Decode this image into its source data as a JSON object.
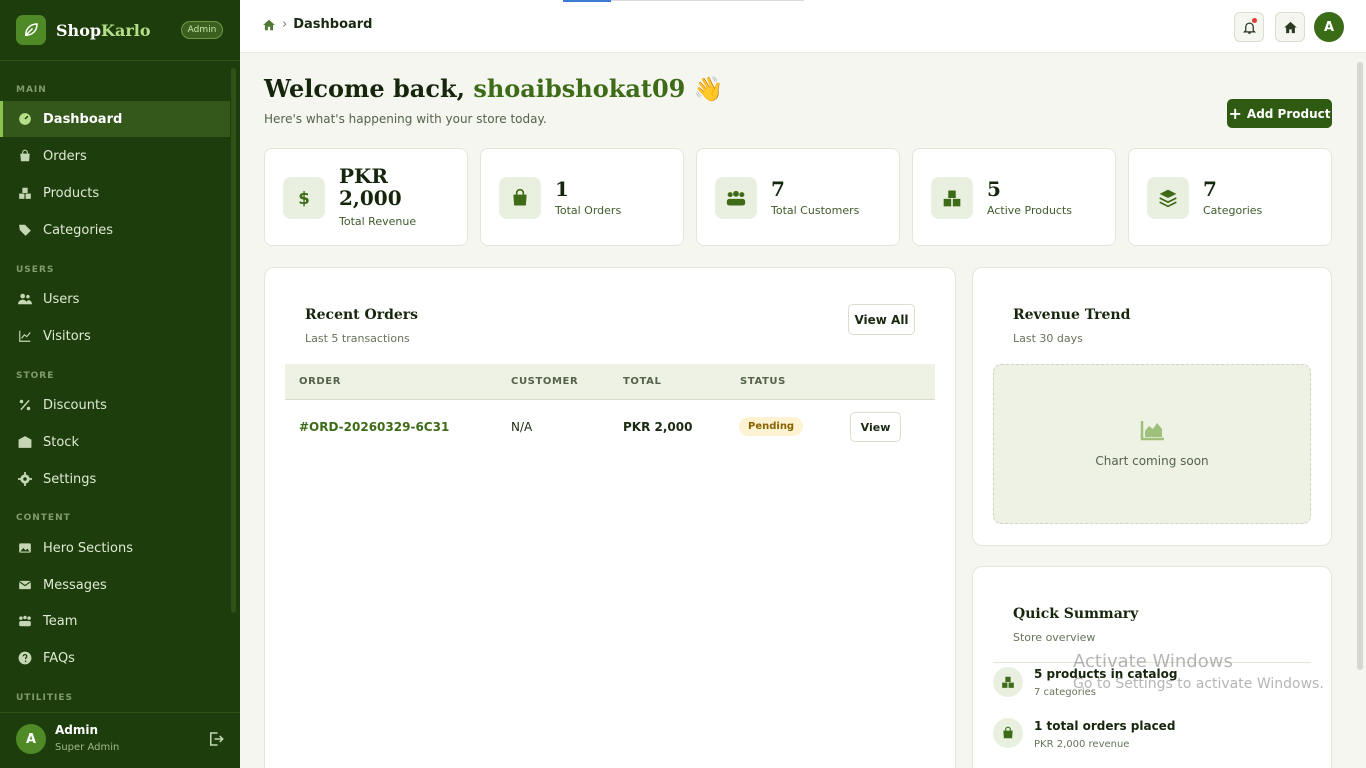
{
  "brand": {
    "name_part1": "Shop",
    "name_part2": "Karlo",
    "badge": "Admin"
  },
  "sidebar": {
    "sections": [
      "MAIN",
      "USERS",
      "STORE",
      "CONTENT",
      "UTILITIES"
    ],
    "items": [
      {
        "label": "Dashboard",
        "icon": "dashboard-icon",
        "active": true
      },
      {
        "label": "Orders",
        "icon": "bag-icon"
      },
      {
        "label": "Products",
        "icon": "boxes-icon"
      },
      {
        "label": "Categories",
        "icon": "tag-icon"
      },
      {
        "label": "Users",
        "icon": "users-icon"
      },
      {
        "label": "Visitors",
        "icon": "chart-line-icon"
      },
      {
        "label": "Discounts",
        "icon": "percent-icon"
      },
      {
        "label": "Stock",
        "icon": "warehouse-icon"
      },
      {
        "label": "Settings",
        "icon": "gear-icon"
      },
      {
        "label": "Hero Sections",
        "icon": "image-icon"
      },
      {
        "label": "Messages",
        "icon": "envelope-icon"
      },
      {
        "label": "Team",
        "icon": "team-icon"
      },
      {
        "label": "FAQs",
        "icon": "question-icon"
      }
    ],
    "footer": {
      "avatar": "A",
      "name": "Admin",
      "role": "Super Admin"
    }
  },
  "topbar": {
    "breadcrumb": "Dashboard",
    "avatar": "A"
  },
  "welcome": {
    "prefix": "Welcome back, ",
    "username": "shoaibshokat09",
    "emoji": "👋",
    "subtitle": "Here's what's happening with your store today."
  },
  "add_product_label": "Add Product",
  "stats": [
    {
      "value": "PKR 2,000",
      "label": "Total Revenue",
      "icon": "dollar-icon"
    },
    {
      "value": "1",
      "label": "Total Orders",
      "icon": "bag-icon"
    },
    {
      "value": "7",
      "label": "Total Customers",
      "icon": "users-icon"
    },
    {
      "value": "5",
      "label": "Active Products",
      "icon": "boxes-icon"
    },
    {
      "value": "7",
      "label": "Categories",
      "icon": "layers-icon"
    }
  ],
  "recent_orders": {
    "title": "Recent Orders",
    "subtitle": "Last 5 transactions",
    "view_all": "View All",
    "columns": [
      "ORDER",
      "CUSTOMER",
      "TOTAL",
      "STATUS"
    ],
    "rows": [
      {
        "order": "#ORD-20260329-6C31",
        "customer": "N/A",
        "total": "PKR 2,000",
        "status": "Pending",
        "action": "View"
      }
    ]
  },
  "revenue_trend": {
    "title": "Revenue Trend",
    "subtitle": "Last 30 days",
    "placeholder": "Chart coming soon"
  },
  "quick_summary": {
    "title": "Quick Summary",
    "subtitle": "Store overview",
    "items": [
      {
        "title": "5 products in catalog",
        "sub": "7 categories"
      },
      {
        "title": "1 total orders placed",
        "sub": "PKR 2,000 revenue"
      }
    ]
  },
  "watermark": {
    "line1": "Activate Windows",
    "line2": "Go to Settings to activate Windows."
  },
  "colors": {
    "sidebar": "#1e3d0c",
    "accent": "#3d6b17",
    "button": "#2f5a12",
    "pending_bg": "#fdf3d2"
  }
}
